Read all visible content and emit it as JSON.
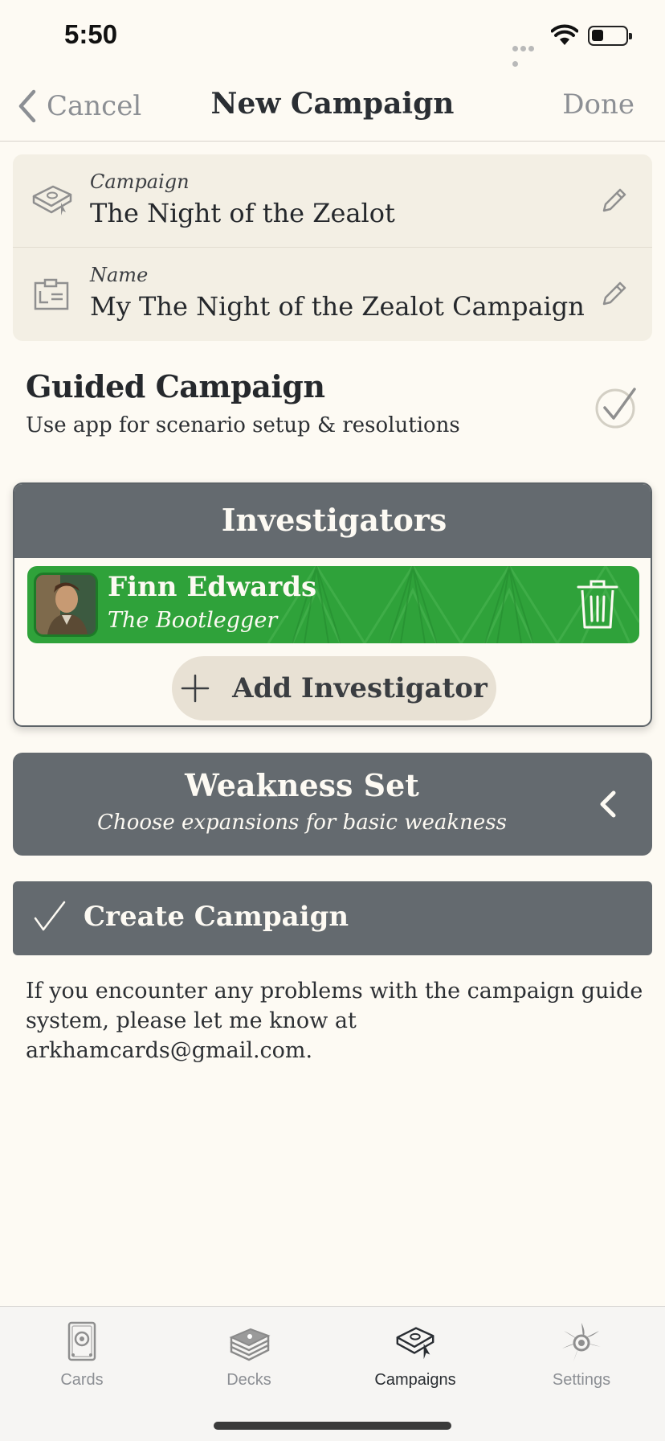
{
  "status_bar": {
    "time": "5:50"
  },
  "nav": {
    "back_label": "Cancel",
    "title": "New Campaign",
    "done_label": "Done"
  },
  "info": {
    "campaign_label": "Campaign",
    "campaign_value": "The Night of the Zealot",
    "name_label": "Name",
    "name_value": "My The Night of the Zealot Campaign"
  },
  "guided": {
    "title": "Guided Campaign",
    "subtitle": "Use app for scenario setup & resolutions",
    "checked": true
  },
  "investigators": {
    "header": "Investigators",
    "items": [
      {
        "name": "Finn Edwards",
        "subtitle": "The Bootlegger",
        "color": "#2fa23a"
      }
    ],
    "add_label": "Add Investigator"
  },
  "weakness": {
    "title": "Weakness Set",
    "subtitle": "Choose expansions for basic weakness"
  },
  "create": {
    "label": "Create Campaign"
  },
  "footer_note": "If you encounter any problems with the campaign guide system, please let me know at arkhamcards@gmail.com.",
  "tabs": [
    {
      "label": "Cards",
      "icon": "cards-icon",
      "active": false
    },
    {
      "label": "Decks",
      "icon": "decks-icon",
      "active": false
    },
    {
      "label": "Campaigns",
      "icon": "campaigns-icon",
      "active": true
    },
    {
      "label": "Settings",
      "icon": "settings-icon",
      "active": false
    }
  ],
  "colors": {
    "background": "#fdfaf3",
    "panel": "#646a6f",
    "card": "#f3efe4",
    "guardian_green": "#2fa23a"
  }
}
